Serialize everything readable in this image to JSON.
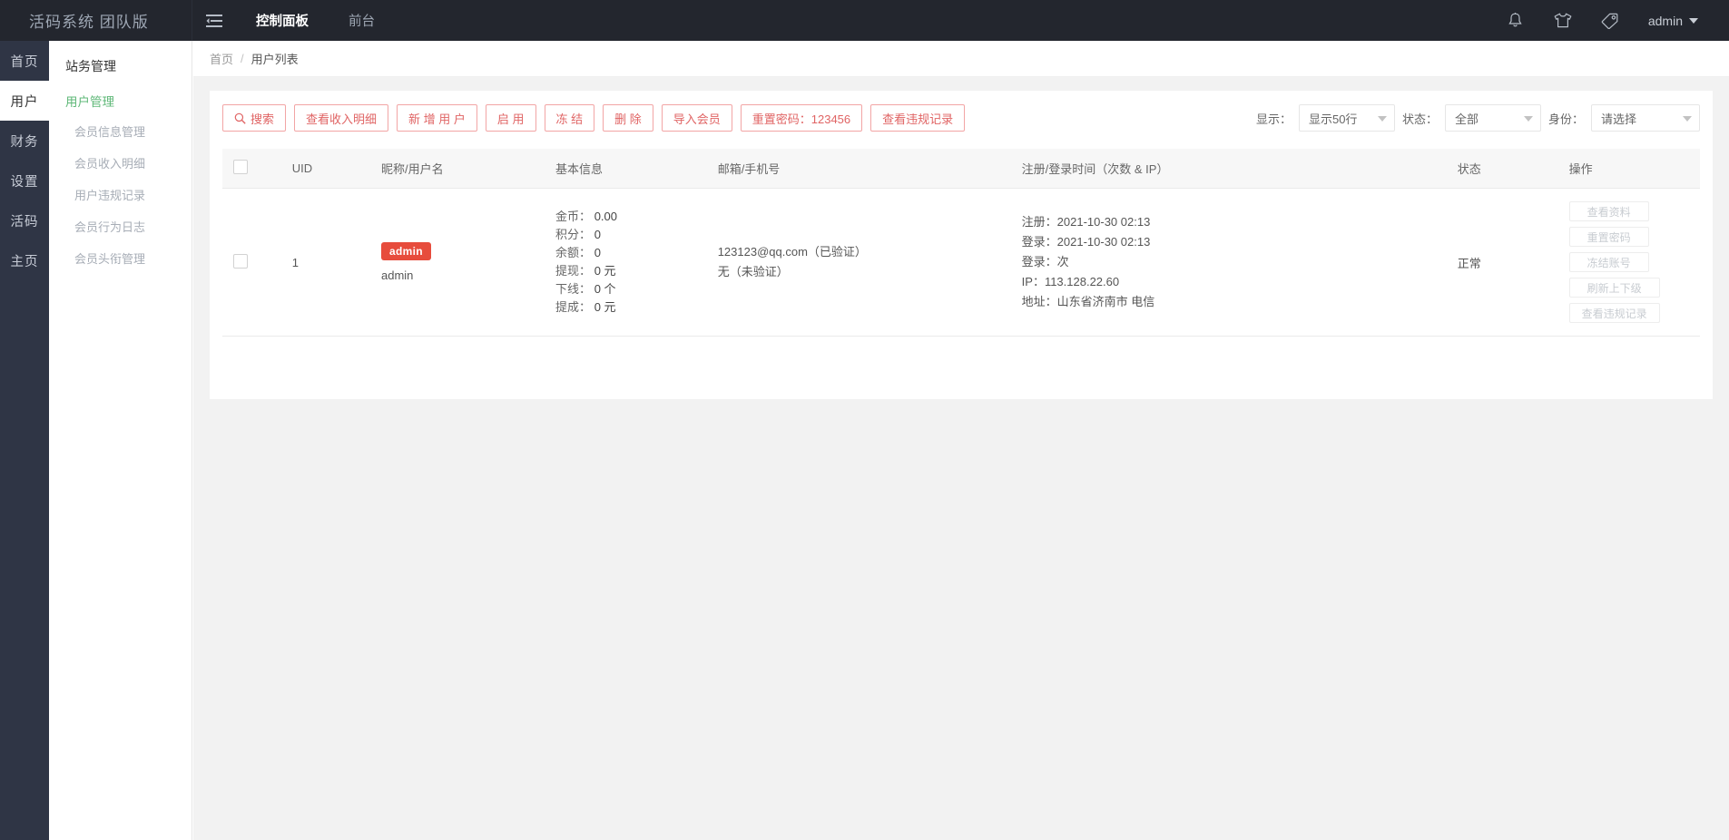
{
  "header": {
    "brand": "活码系统 团队版",
    "collapse_icon": "menu-collapse-icon",
    "tabs": [
      {
        "label": "控制面板",
        "active": true
      },
      {
        "label": "前台",
        "active": false
      }
    ],
    "icons": [
      {
        "name": "bell-icon"
      },
      {
        "name": "tshirt-icon"
      },
      {
        "name": "tag-icon"
      }
    ],
    "user": "admin"
  },
  "rail": {
    "items": [
      {
        "label": "首页",
        "active": false
      },
      {
        "label": "用户",
        "active": true
      },
      {
        "label": "财务",
        "active": false
      },
      {
        "label": "设置",
        "active": false
      },
      {
        "label": "活码",
        "active": false
      },
      {
        "label": "主页",
        "active": false
      }
    ]
  },
  "subnav": {
    "title": "站务管理",
    "group": "用户管理",
    "items": [
      {
        "label": "会员信息管理"
      },
      {
        "label": "会员收入明细"
      },
      {
        "label": "用户违规记录"
      },
      {
        "label": "会员行为日志"
      },
      {
        "label": "会员头衔管理"
      }
    ]
  },
  "breadcrumb": {
    "home": "首页",
    "separator": "/",
    "current": "用户列表"
  },
  "toolbar": {
    "buttons": [
      {
        "label": "搜索",
        "icon": "search-icon"
      },
      {
        "label": "查看收入明细",
        "icon": null
      },
      {
        "label": "新 增 用 户",
        "icon": null
      },
      {
        "label": "启 用",
        "icon": null
      },
      {
        "label": "冻 结",
        "icon": null
      },
      {
        "label": "删 除",
        "icon": null
      },
      {
        "label": "导入会员",
        "icon": null
      },
      {
        "label": "重置密码：123456",
        "icon": null
      },
      {
        "label": "查看违规记录",
        "icon": null
      }
    ],
    "filters": [
      {
        "label": "显示：",
        "value": "显示50行",
        "name": "rows-per-page-select"
      },
      {
        "label": "状态：",
        "value": "全部",
        "name": "status-filter-select"
      },
      {
        "label": "身份：",
        "value": "请选择",
        "name": "role-filter-select"
      }
    ]
  },
  "table": {
    "columns": [
      {
        "key": "checkbox",
        "label": ""
      },
      {
        "key": "uid",
        "label": "UID"
      },
      {
        "key": "nickname",
        "label": "昵称/用户名"
      },
      {
        "key": "basic",
        "label": "基本信息"
      },
      {
        "key": "contact",
        "label": "邮箱/手机号"
      },
      {
        "key": "time",
        "label": "注册/登录时间（次数 & IP）"
      },
      {
        "key": "status",
        "label": "状态"
      },
      {
        "key": "operation",
        "label": "操作"
      }
    ],
    "rows": [
      {
        "uid": "1",
        "nickname_badge": "admin",
        "nickname_sub": "admin",
        "basic": [
          {
            "k": "金币：",
            "v": "0.00"
          },
          {
            "k": "积分：",
            "v": "0"
          },
          {
            "k": "余额：",
            "v": "0"
          },
          {
            "k": "提现：",
            "v": "0 元"
          },
          {
            "k": "下线：",
            "v": "0 个"
          },
          {
            "k": "提成：",
            "v": "0 元"
          }
        ],
        "contact": [
          "123123@qq.com（已验证）",
          "无（未验证）"
        ],
        "time": [
          "注册：2021-10-30 02:13",
          "登录：2021-10-30 02:13",
          "登录：次",
          "IP：113.128.22.60",
          "地址：山东省济南市 电信"
        ],
        "status": "正常",
        "operations": [
          "查看资料",
          "重置密码",
          "冻结账号",
          "刷新上下级",
          "查看违规记录"
        ]
      }
    ]
  },
  "colors": {
    "header_bg": "#23262E",
    "rail_bg": "#2F3545",
    "accent_green": "#5FB878",
    "danger_red": "#e06464",
    "badge_red": "#E74C3C"
  }
}
